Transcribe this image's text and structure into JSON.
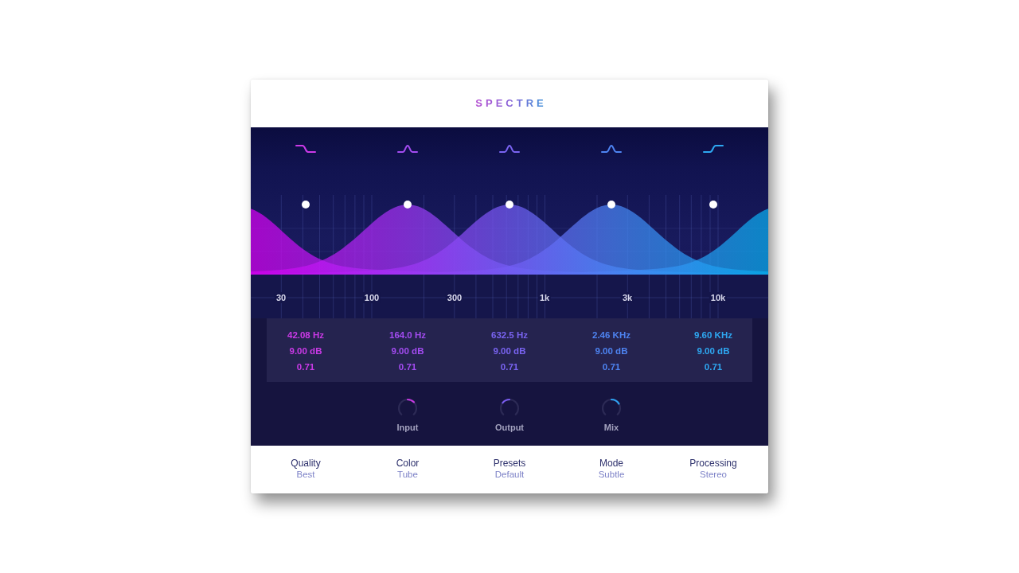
{
  "plugin": {
    "title": "SPECTRE"
  },
  "bands": [
    {
      "kind": "low-shelf",
      "color": "#cc3ae8",
      "frequency": "42.08 Hz",
      "gain": "9.00 dB",
      "q": "0.71"
    },
    {
      "kind": "bell",
      "color": "#a44cf2",
      "frequency": "164.0 Hz",
      "gain": "9.00 dB",
      "q": "0.71"
    },
    {
      "kind": "bell",
      "color": "#7a64f2",
      "frequency": "632.5 Hz",
      "gain": "9.00 dB",
      "q": "0.71"
    },
    {
      "kind": "bell",
      "color": "#4e84f2",
      "frequency": "2.46 KHz",
      "gain": "9.00 dB",
      "q": "0.71"
    },
    {
      "kind": "high-shelf",
      "color": "#2ea8f2",
      "frequency": "9.60 KHz",
      "gain": "9.00 dB",
      "q": "0.71"
    }
  ],
  "frequency_axis": {
    "labels": [
      "30",
      "100",
      "300",
      "1k",
      "3k",
      "10k"
    ]
  },
  "knobs": [
    {
      "label": "Input",
      "level": 0.67,
      "color": "#c43ae0"
    },
    {
      "label": "Output",
      "level": 0.31,
      "color": "#7a5cf0"
    },
    {
      "label": "Mix",
      "level": 0.72,
      "color": "#2ea0f0"
    }
  ],
  "settings": [
    {
      "label": "Quality",
      "value": "Best"
    },
    {
      "label": "Color",
      "value": "Tube"
    },
    {
      "label": "Presets",
      "value": "Default"
    },
    {
      "label": "Mode",
      "value": "Subtle"
    },
    {
      "label": "Processing",
      "value": "Stereo"
    }
  ]
}
